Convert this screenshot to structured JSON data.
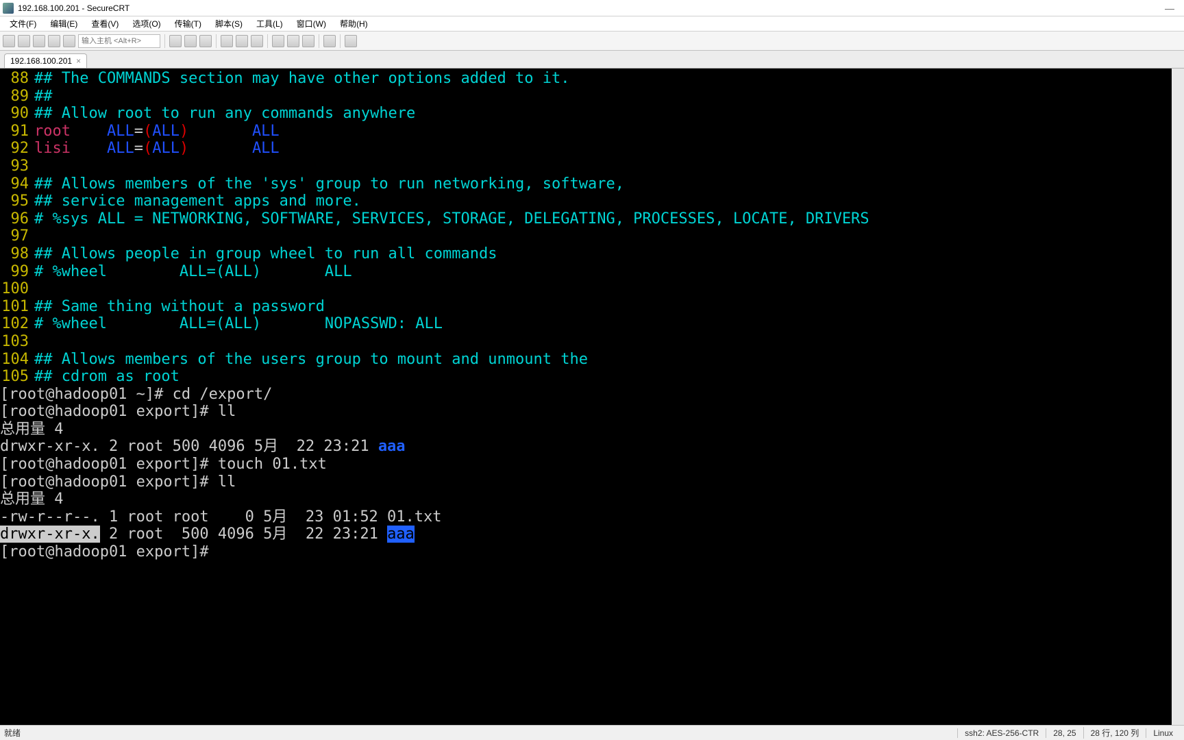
{
  "titlebar": {
    "title": "192.168.100.201 - SecureCRT"
  },
  "menubar": {
    "items": [
      "文件(F)",
      "编辑(E)",
      "查看(V)",
      "选项(O)",
      "传输(T)",
      "脚本(S)",
      "工具(L)",
      "窗口(W)",
      "帮助(H)"
    ]
  },
  "toolbar": {
    "host_placeholder": "输入主机 <Alt+R>"
  },
  "tab": {
    "label": "192.168.100.201",
    "close": "×"
  },
  "terminal": {
    "lines": [
      {
        "num": "88",
        "type": "comment",
        "text": "## The COMMANDS section may have other options added to it."
      },
      {
        "num": "89",
        "type": "comment",
        "text": "##"
      },
      {
        "num": "90",
        "type": "comment",
        "text": "## Allow root to run any commands anywhere"
      },
      {
        "num": "91",
        "type": "sudo",
        "user": "root",
        "all1": "ALL",
        "eq": "=(",
        "all2": "ALL",
        "close": ")",
        "all3": "ALL"
      },
      {
        "num": "92",
        "type": "sudo",
        "user": "lisi",
        "all1": "ALL",
        "eq": "=(",
        "all2": "ALL",
        "close": ")",
        "all3": "ALL"
      },
      {
        "num": "93",
        "type": "blank",
        "text": ""
      },
      {
        "num": "94",
        "type": "comment",
        "text": "## Allows members of the 'sys' group to run networking, software,"
      },
      {
        "num": "95",
        "type": "comment",
        "text": "## service management apps and more."
      },
      {
        "num": "96",
        "type": "comment",
        "text": "# %sys ALL = NETWORKING, SOFTWARE, SERVICES, STORAGE, DELEGATING, PROCESSES, LOCATE, DRIVERS"
      },
      {
        "num": "97",
        "type": "blank",
        "text": ""
      },
      {
        "num": "98",
        "type": "comment",
        "text": "## Allows people in group wheel to run all commands"
      },
      {
        "num": "99",
        "type": "comment",
        "text": "# %wheel        ALL=(ALL)       ALL"
      },
      {
        "num": "100",
        "type": "blank",
        "text": ""
      },
      {
        "num": "101",
        "type": "comment",
        "text": "## Same thing without a password"
      },
      {
        "num": "102",
        "type": "comment",
        "text": "# %wheel        ALL=(ALL)       NOPASSWD: ALL"
      },
      {
        "num": "103",
        "type": "blank",
        "text": ""
      },
      {
        "num": "104",
        "type": "comment",
        "text": "## Allows members of the users group to mount and unmount the"
      },
      {
        "num": "105",
        "type": "comment",
        "text": "## cdrom as root"
      }
    ],
    "shell": {
      "p1_prompt": "[root@hadoop01 ~]# ",
      "p1_cmd": "cd /export/",
      "p2_prompt": "[root@hadoop01 export]# ",
      "p2_cmd": "ll",
      "total1": "总用量 4",
      "ls1_pre": "drwxr-xr-x. 2 root 500 4096 5月  22 23:21 ",
      "ls1_dir": "aaa",
      "p3_prompt": "[root@hadoop01 export]# ",
      "p3_cmd": "touch 01.txt",
      "p4_prompt": "[root@hadoop01 export]# ",
      "p4_cmd": "ll",
      "total2": "总用量 4",
      "ls2a": "-rw-r--r--. 1 root root    0 5月  23 01:52 01.txt",
      "ls2b_hl": "drwxr-xr-x.",
      "ls2b_mid": " 2 root  500 4096 5月  22 23:21 ",
      "ls2b_dir": "aaa",
      "p5_prompt": "[root@hadoop01 export]# "
    }
  },
  "statusbar": {
    "left": "就绪",
    "proto": "ssh2: AES-256-CTR",
    "pos": "28, 25",
    "size": "28 行, 120 列",
    "os": "Linux"
  }
}
